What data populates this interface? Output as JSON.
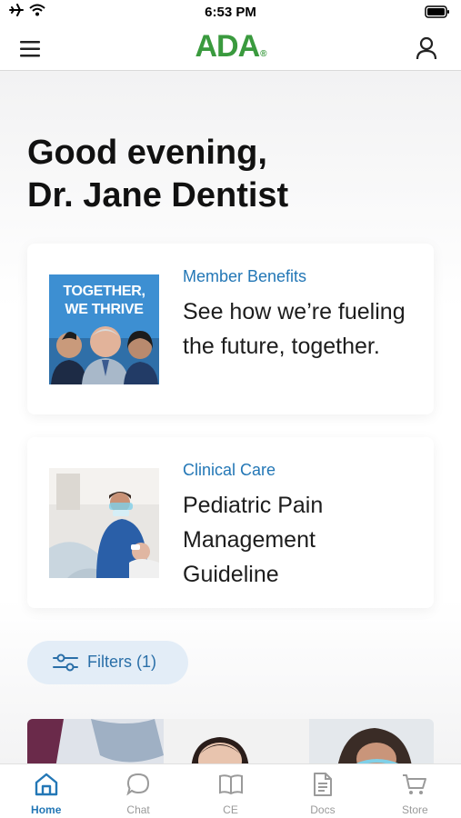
{
  "status_bar": {
    "time": "6:53 PM"
  },
  "nav": {
    "logo": "ADA",
    "logo_mark": "®"
  },
  "greeting": {
    "line1": "Good evening,",
    "line2": "Dr. Jane Dentist"
  },
  "cards": [
    {
      "category": "Member Benefits",
      "title": "See how we’re fueling the future, together.",
      "image_text_line1": "TOGETHER,",
      "image_text_line2": "WE THRIVE"
    },
    {
      "category": "Clinical Care",
      "title": "Pediatric Pain Management Guideline"
    }
  ],
  "filters": {
    "label": "Filters (1)"
  },
  "tabs": [
    {
      "label": "Home",
      "icon": "home-icon",
      "active": true
    },
    {
      "label": "Chat",
      "icon": "chat-icon",
      "active": false
    },
    {
      "label": "CE",
      "icon": "book-icon",
      "active": false
    },
    {
      "label": "Docs",
      "icon": "document-icon",
      "active": false
    },
    {
      "label": "Store",
      "icon": "cart-icon",
      "active": false
    }
  ],
  "colors": {
    "brand_green": "#3a9a3e",
    "accent_blue": "#2377b6",
    "filter_bg": "#e3edf7"
  }
}
